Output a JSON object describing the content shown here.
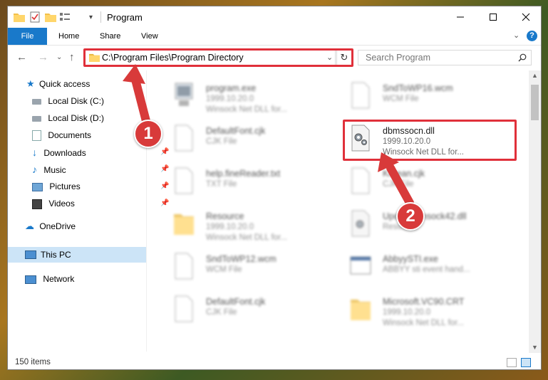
{
  "window": {
    "title": "Program",
    "file_tab": "File",
    "tabs": [
      "Home",
      "Share",
      "View"
    ]
  },
  "address": {
    "path": "C:\\Program Files\\Program Directory",
    "search_placeholder": "Search Program"
  },
  "nav": {
    "quick_access": "Quick access",
    "items": [
      "Local Disk (C:)",
      "Local Disk (D:)",
      "Documents",
      "Downloads",
      "Music",
      "Pictures",
      "Videos"
    ],
    "onedrive": "OneDrive",
    "this_pc": "This PC",
    "network": "Network"
  },
  "files": {
    "left": [
      {
        "name": "program.exe",
        "line2": "1999.10.20.0",
        "line3": "Winsock Net DLL for..."
      },
      {
        "name": "DefaultFont.cjk",
        "line2": "CJK File"
      },
      {
        "name": "help.fineReader.txt",
        "line2": "TXT File"
      },
      {
        "name": "Resource",
        "line2": "1999.10.20.0",
        "line3": "Winsock Net DLL for..."
      },
      {
        "name": "SndToWP12.wcm",
        "line2": "WCM File"
      },
      {
        "name": "DefaultFont.cjk",
        "line2": "CJK File"
      }
    ],
    "right": [
      {
        "name": "SndToWP16.wcm",
        "line2": "WCM File"
      },
      {
        "name": "dbmssocn.dll",
        "line2": "1999.10.20.0",
        "line3": "Winsock Net DLL for..."
      },
      {
        "name": "Korean.cjk",
        "line2": "CJK File"
      },
      {
        "name": "UpdateWinsock42.dll",
        "line2": "Resource"
      },
      {
        "name": "AbbyySTI.exe",
        "line2": "ABBYY sti event hand..."
      },
      {
        "name": "Microsoft.VC90.CRT",
        "line2": "1999.10.20.0",
        "line3": "Winsock Net DLL for..."
      }
    ]
  },
  "status": {
    "count": "150 items"
  },
  "markers": [
    "1",
    "2"
  ],
  "colors": {
    "accent": "#1979ca",
    "highlight": "#e0303a",
    "selected": "#cce4f7"
  }
}
